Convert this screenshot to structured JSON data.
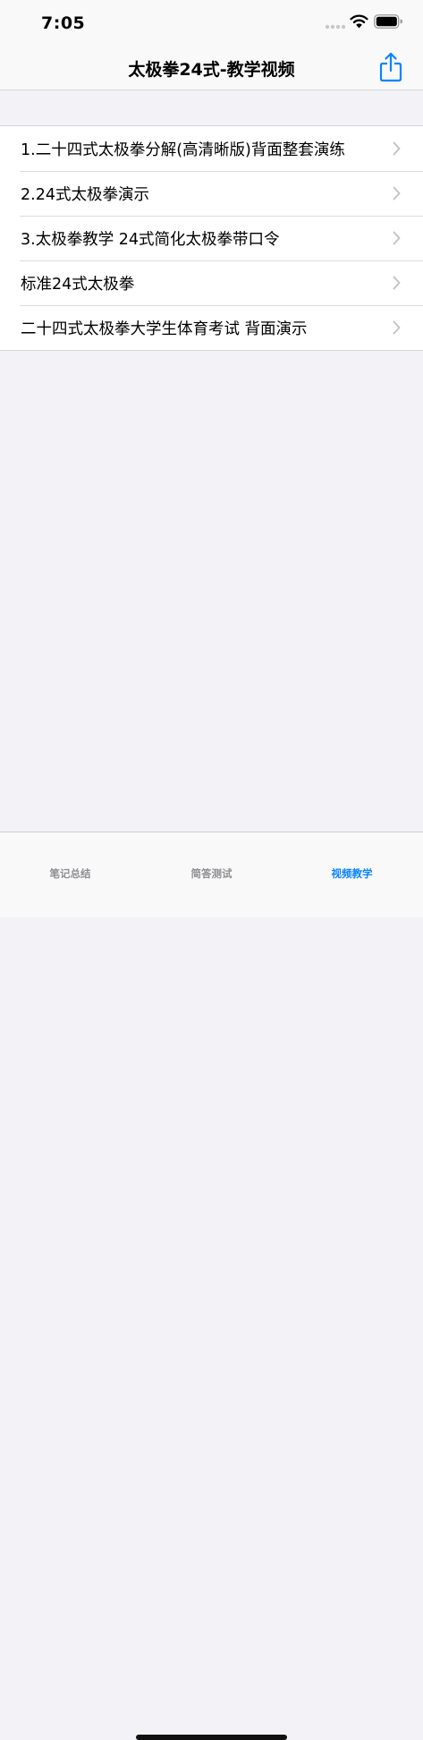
{
  "status_bar": {
    "time": "7:05"
  },
  "nav": {
    "title": "太极拳24式-教学视频",
    "share_icon": "share-icon"
  },
  "list": {
    "items": [
      {
        "label": "1.二十四式太极拳分解(高清晰版)背面整套演练"
      },
      {
        "label": "2.24式太极拳演示"
      },
      {
        "label": "3.太极拳教学 24式简化太极拳带口令"
      },
      {
        "label": "标准24式太极拳"
      },
      {
        "label": "二十四式太极拳大学生体育考试 背面演示"
      }
    ]
  },
  "tabs": [
    {
      "label": "笔记总结",
      "active": false
    },
    {
      "label": "简答测试",
      "active": false
    },
    {
      "label": "视频教学",
      "active": true
    }
  ],
  "colors": {
    "accent": "#0a84ff",
    "tab_inactive": "#8e8e93",
    "background": "#f2f2f7"
  }
}
